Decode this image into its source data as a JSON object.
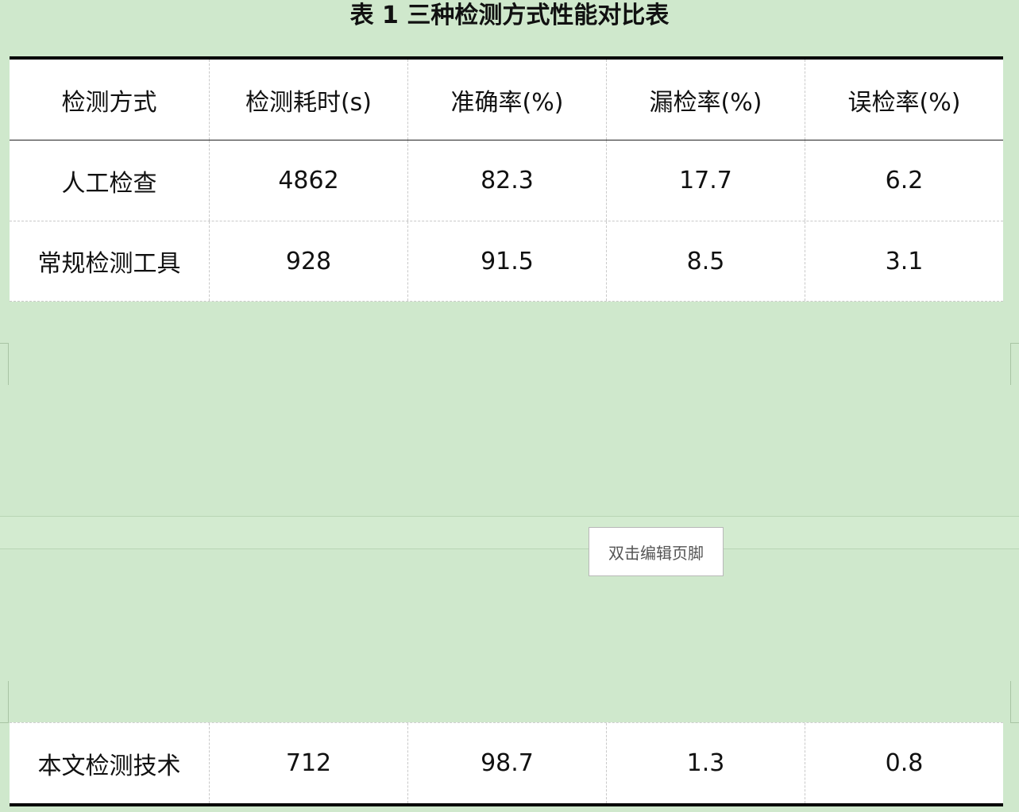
{
  "title": "表 1 三种检测方式性能对比表",
  "table": {
    "headers": [
      "检测方式",
      "检测耗时(s)",
      "准确率(%)",
      "漏检率(%)",
      "误检率(%)"
    ],
    "rows": [
      [
        "人工检查",
        "4862",
        "82.3",
        "17.7",
        "6.2"
      ],
      [
        "常规检测工具",
        "928",
        "91.5",
        "8.5",
        "3.1"
      ],
      [
        "本文检测技术",
        "712",
        "98.7",
        "1.3",
        "0.8"
      ]
    ]
  },
  "footer": {
    "edit_label": "双击编辑页脚"
  }
}
